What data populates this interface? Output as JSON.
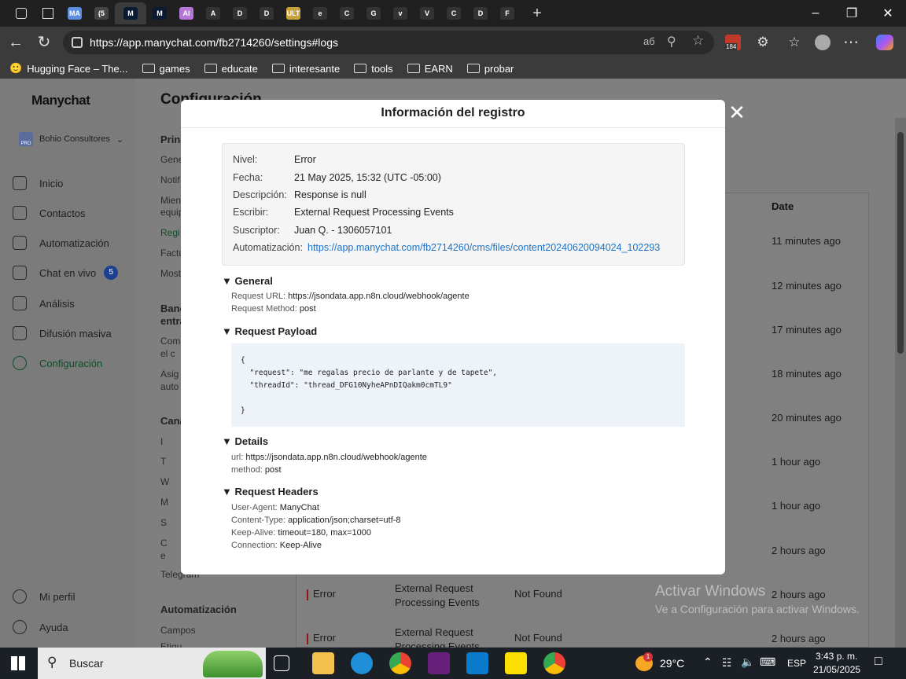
{
  "browser": {
    "tabs": [
      {
        "label": "MA",
        "color": "#5b8de0"
      },
      {
        "label": "(5",
        "color": "#444"
      },
      {
        "label": "M",
        "color": "#0b1a33"
      },
      {
        "label": "M",
        "color": "#0b1a33"
      },
      {
        "label": "AI",
        "color": "#b675d8"
      },
      {
        "label": "A",
        "color": "#333"
      },
      {
        "label": "D",
        "color": "#333"
      },
      {
        "label": "D",
        "color": "#333"
      },
      {
        "label": "ULT",
        "color": "#c7a23a"
      },
      {
        "label": "e",
        "color": "#333"
      },
      {
        "label": "C",
        "color": "#333"
      },
      {
        "label": "G",
        "color": "#333"
      },
      {
        "label": "v",
        "color": "#333"
      },
      {
        "label": "V",
        "color": "#333"
      },
      {
        "label": "C",
        "color": "#333"
      },
      {
        "label": "D",
        "color": "#333"
      },
      {
        "label": "F",
        "color": "#333"
      }
    ],
    "url": "https://app.manychat.com/fb2714260/settings#logs",
    "bookmarks": [
      "Hugging Face – The...",
      "games",
      "educate",
      "interesante",
      "tools",
      "EARN",
      "probar"
    ],
    "ext_badge": "184"
  },
  "sidebar": {
    "logo": "Manychat",
    "account": "Bohio Consultores",
    "account_tag": "PRO",
    "items": [
      {
        "label": "Inicio",
        "icon": "home-icon"
      },
      {
        "label": "Contactos",
        "icon": "contacts-icon"
      },
      {
        "label": "Automatización",
        "icon": "automation-icon"
      },
      {
        "label": "Chat en vivo",
        "icon": "chat-icon",
        "badge": "5"
      },
      {
        "label": "Análisis",
        "icon": "analytics-icon"
      },
      {
        "label": "Difusión masiva",
        "icon": "broadcast-icon"
      },
      {
        "label": "Configuración",
        "icon": "settings-icon",
        "active": true
      }
    ],
    "bottom": [
      {
        "label": "Mi perfil",
        "icon": "profile-icon"
      },
      {
        "label": "Ayuda",
        "icon": "help-icon"
      }
    ]
  },
  "settings": {
    "title": "Configuración",
    "sub": [
      {
        "label": "Princ",
        "head": true
      },
      {
        "label": "Gene"
      },
      {
        "label": "Notif"
      },
      {
        "label": "Mien"
      },
      {
        "label": "equip"
      },
      {
        "label": "Regi"
      },
      {
        "label": "Factu"
      },
      {
        "label": "Most"
      },
      {
        "label": "Banc",
        "head": true
      },
      {
        "label": "entra",
        "head": true
      },
      {
        "label": "Com"
      },
      {
        "label": "el c"
      },
      {
        "label": "Asig"
      },
      {
        "label": "auto"
      },
      {
        "label": "Cana",
        "head": true
      },
      {
        "label": "I"
      },
      {
        "label": "T"
      },
      {
        "label": "W"
      },
      {
        "label": "M"
      },
      {
        "label": "S"
      },
      {
        "label": "C"
      },
      {
        "label": "e"
      },
      {
        "label": "Telegram"
      },
      {
        "label": "Automatización",
        "head": true
      },
      {
        "label": "Campos"
      },
      {
        "label": "Etiqu"
      }
    ]
  },
  "log_table": {
    "date_header": "Date",
    "dates": [
      "11 minutes ago",
      "12 minutes ago",
      "17 minutes ago",
      "18 minutes ago",
      "20 minutes ago",
      "1 hour ago",
      "1 hour ago",
      "2 hours ago"
    ],
    "visible_rows": [
      {
        "level": "Error",
        "event": "External Request Processing Events",
        "status": "Not Found",
        "date": "2 hours ago"
      },
      {
        "level": "Error",
        "event": "External Request Processing Events",
        "status": "Not Found",
        "date": "2 hours ago"
      }
    ]
  },
  "watermark": {
    "line1": "Activar Windows",
    "line2": "Ve a Configuración para activar Windows."
  },
  "modal": {
    "title": "Información del registro",
    "info": [
      {
        "key": "Nivel:",
        "value": "Error"
      },
      {
        "key": "Fecha:",
        "value": "21 May 2025, 15:32 (UTC -05:00)"
      },
      {
        "key": "Descripción:",
        "value": "Response is null"
      },
      {
        "key": "Escribir:",
        "value": "External Request Processing Events"
      },
      {
        "key": "Suscriptor:",
        "value": "Juan Q. - 1306057101"
      },
      {
        "key": "Automatización:",
        "value": "https://app.manychat.com/fb2714260/cms/files/content20240620094024_102293",
        "link": true
      }
    ],
    "sections": {
      "general": {
        "title": "General",
        "rows": [
          {
            "key": "Request URL:",
            "value": "https://jsondata.app.n8n.cloud/webhook/agente"
          },
          {
            "key": "Request Method:",
            "value": "post"
          }
        ]
      },
      "payload": {
        "title": "Request Payload",
        "body": "{\n  \"request\": \"me regalas precio de parlante y de tapete\",\n  \"threadId\": \"thread_DFG10NyheAPnDIQakm0cmTL9\"\n\n}"
      },
      "details": {
        "title": "Details",
        "rows": [
          {
            "key": "url:",
            "value": "https://jsondata.app.n8n.cloud/webhook/agente"
          },
          {
            "key": "method:",
            "value": "post"
          }
        ]
      },
      "headers": {
        "title": "Request Headers",
        "rows": [
          {
            "key": "User-Agent:",
            "value": "ManyChat"
          },
          {
            "key": "Content-Type:",
            "value": "application/json;charset=utf-8"
          },
          {
            "key": "Keep-Alive:",
            "value": "timeout=180, max=1000"
          },
          {
            "key": "Connection:",
            "value": "Keep-Alive"
          }
        ]
      }
    }
  },
  "taskbar": {
    "search": "Buscar",
    "weather": "29°C",
    "lang": "ESP",
    "time": "3:43 p. m.",
    "date": "21/05/2025",
    "weather_badge": "1"
  }
}
